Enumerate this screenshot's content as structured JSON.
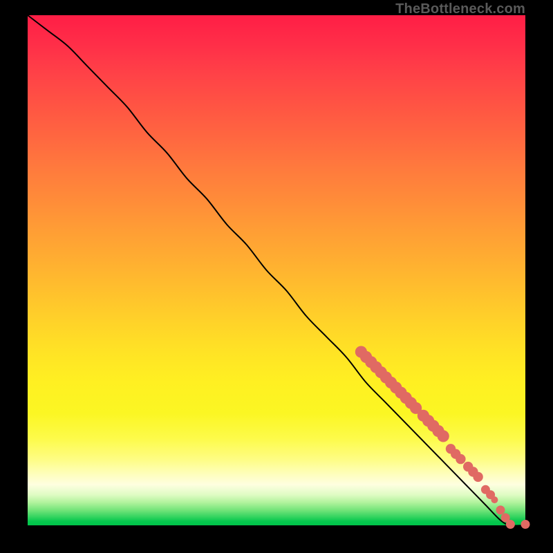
{
  "attribution": "TheBottleneck.com",
  "colors": {
    "background": "#000000",
    "curve": "#000000",
    "marker": "#e06a63",
    "gradient_top": "#ff1e46",
    "gradient_bottom": "#00c44a"
  },
  "chart_data": {
    "type": "line",
    "title": "",
    "xlabel": "",
    "ylabel": "",
    "xlim": [
      0,
      100
    ],
    "ylim": [
      0,
      100
    ],
    "grid": false,
    "legend": false,
    "series": [
      {
        "name": "bottleneck-curve",
        "x": [
          0,
          4,
          8,
          12,
          16,
          20,
          24,
          28,
          32,
          36,
          40,
          44,
          48,
          52,
          56,
          60,
          64,
          68,
          72,
          76,
          80,
          84,
          88,
          92,
          95,
          97,
          100
        ],
        "y": [
          100,
          97,
          94,
          90,
          86,
          82,
          77,
          73,
          68,
          64,
          59,
          55,
          50,
          46,
          41,
          37,
          33,
          28,
          24,
          20,
          16,
          12,
          8,
          4,
          1,
          0,
          0
        ]
      }
    ],
    "markers": [
      {
        "x": 67,
        "y": 34,
        "r": 1.2
      },
      {
        "x": 68,
        "y": 33,
        "r": 1.2
      },
      {
        "x": 69,
        "y": 32,
        "r": 1.2
      },
      {
        "x": 70,
        "y": 31,
        "r": 1.2
      },
      {
        "x": 71,
        "y": 30,
        "r": 1.2
      },
      {
        "x": 72,
        "y": 29,
        "r": 1.2
      },
      {
        "x": 73,
        "y": 28,
        "r": 1.2
      },
      {
        "x": 74,
        "y": 27,
        "r": 1.2
      },
      {
        "x": 75,
        "y": 26,
        "r": 1.2
      },
      {
        "x": 76,
        "y": 25,
        "r": 1.2
      },
      {
        "x": 77,
        "y": 24,
        "r": 1.2
      },
      {
        "x": 78,
        "y": 23,
        "r": 1.2
      },
      {
        "x": 79.5,
        "y": 21.5,
        "r": 1.2
      },
      {
        "x": 80.5,
        "y": 20.5,
        "r": 1.2
      },
      {
        "x": 81.5,
        "y": 19.5,
        "r": 1.2
      },
      {
        "x": 82.5,
        "y": 18.5,
        "r": 1.2
      },
      {
        "x": 83.5,
        "y": 17.5,
        "r": 1.2
      },
      {
        "x": 85,
        "y": 15,
        "r": 1.0
      },
      {
        "x": 86,
        "y": 14,
        "r": 1.0
      },
      {
        "x": 87,
        "y": 13,
        "r": 1.0
      },
      {
        "x": 88.5,
        "y": 11.5,
        "r": 1.0
      },
      {
        "x": 89.5,
        "y": 10.5,
        "r": 1.0
      },
      {
        "x": 90.5,
        "y": 9.5,
        "r": 1.0
      },
      {
        "x": 92,
        "y": 7,
        "r": 0.9
      },
      {
        "x": 93,
        "y": 6,
        "r": 0.9
      },
      {
        "x": 93.8,
        "y": 5,
        "r": 0.7
      },
      {
        "x": 95,
        "y": 3,
        "r": 0.9
      },
      {
        "x": 96,
        "y": 1.5,
        "r": 0.9
      },
      {
        "x": 97,
        "y": 0.2,
        "r": 0.9
      },
      {
        "x": 100,
        "y": 0.2,
        "r": 0.9
      }
    ]
  }
}
